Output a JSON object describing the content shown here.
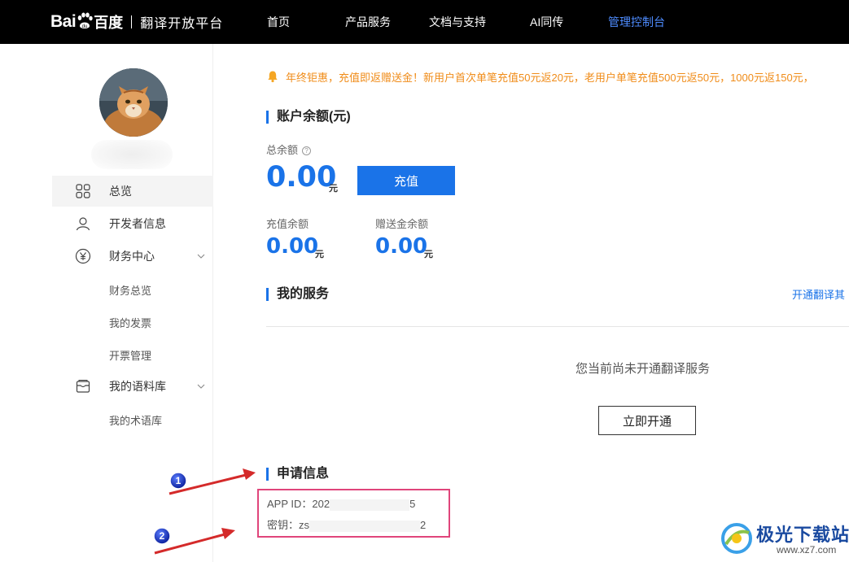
{
  "header": {
    "logo_text": "Bai",
    "logo_cn": "百度",
    "logo_subtitle": "翻译开放平台",
    "nav": [
      {
        "label": "首页"
      },
      {
        "label": "产品服务"
      },
      {
        "label": "文档与支持"
      },
      {
        "label": "AI同传"
      },
      {
        "label": "管理控制台"
      }
    ],
    "active_nav": "管理控制台",
    "active_color": "#4e8cff"
  },
  "sidebar": {
    "avatar": "cat-avatar",
    "items": [
      {
        "label": "总览",
        "icon": "grid-icon"
      },
      {
        "label": "开发者信息",
        "icon": "user-icon"
      },
      {
        "label": "财务中心",
        "icon": "yen-icon"
      },
      {
        "label": "我的语料库",
        "icon": "inbox-icon"
      }
    ],
    "finance_sub": [
      {
        "label": "财务总览"
      },
      {
        "label": "我的发票"
      },
      {
        "label": "开票管理"
      }
    ],
    "corpus_sub": [
      {
        "label": "我的术语库"
      }
    ]
  },
  "notice": {
    "text": "年终钜惠，充值即返赠送金！新用户首次单笔充值50元返20元，老用户单笔充值500元返50元，1000元返150元，",
    "color": "#f08c19"
  },
  "balance": {
    "title": "账户余额(元)",
    "total_label": "总余额",
    "total_value": "0.00",
    "unit": "元",
    "recharge_button": "充值",
    "recharge_label": "充值余额",
    "recharge_value": "0.00",
    "gift_label": "赠送金余额",
    "gift_value": "0.00",
    "accent_color": "#1a73e8"
  },
  "services": {
    "title": "我的服务",
    "link": "开通翻译其",
    "empty_text": "您当前尚未开通翻译服务",
    "open_button": "立即开通"
  },
  "application": {
    "title": "申请信息",
    "app_id_label": "APP ID：",
    "app_id_prefix": "202",
    "app_id_suffix": "5",
    "key_label": "密钥：",
    "key_prefix": "zs",
    "key_suffix": "2",
    "highlight_color": "#e0457b"
  },
  "annotations": [
    {
      "number": "1"
    },
    {
      "number": "2"
    }
  ],
  "watermark": {
    "text": "极光下载站",
    "url": "www.xz7.com"
  }
}
